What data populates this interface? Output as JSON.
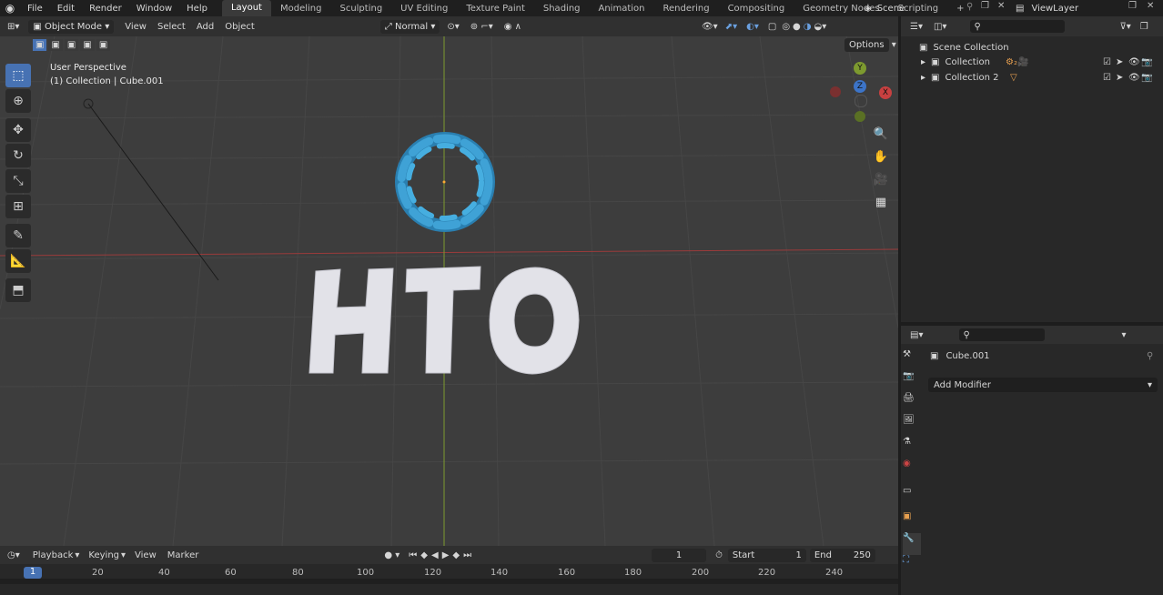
{
  "topbar": {
    "menus": [
      "File",
      "Edit",
      "Render",
      "Window",
      "Help"
    ],
    "workspaces": [
      "Layout",
      "Modeling",
      "Sculpting",
      "UV Editing",
      "Texture Paint",
      "Shading",
      "Animation",
      "Rendering",
      "Compositing",
      "Geometry Nodes",
      "Scripting"
    ],
    "active_workspace": "Layout",
    "add_tab": "+",
    "scene": "Scene",
    "view_layer": "ViewLayer"
  },
  "viewport_header": {
    "mode": "Object Mode",
    "menus": [
      "View",
      "Select",
      "Add",
      "Object"
    ],
    "orientation": "Normal",
    "options": "Options"
  },
  "viewport": {
    "perspective": "User Perspective",
    "object_info": "(1) Collection | Cube.001",
    "axis_x": "X",
    "axis_y": "Y",
    "axis_z": "Z",
    "text_object": "HTO",
    "colors": {
      "logo": "#3fa2d6",
      "text": "#e2e2e8",
      "background": "#3d3d3d",
      "axis_red": "#b84a4a",
      "axis_green": "#8aa33a"
    }
  },
  "outliner": {
    "root": "Scene Collection",
    "collections": [
      {
        "name": "Collection"
      },
      {
        "name": "Collection 2"
      }
    ]
  },
  "properties": {
    "object_name": "Cube.001",
    "add_modifier": "Add Modifier"
  },
  "timeline": {
    "menus": [
      "Playback",
      "Keying",
      "View",
      "Marker"
    ],
    "current_frame": "1",
    "start_label": "Start",
    "start": "1",
    "end_label": "End",
    "end": "250",
    "ruler": [
      "1",
      "20",
      "40",
      "60",
      "80",
      "100",
      "120",
      "140",
      "160",
      "180",
      "200",
      "220",
      "240"
    ]
  }
}
